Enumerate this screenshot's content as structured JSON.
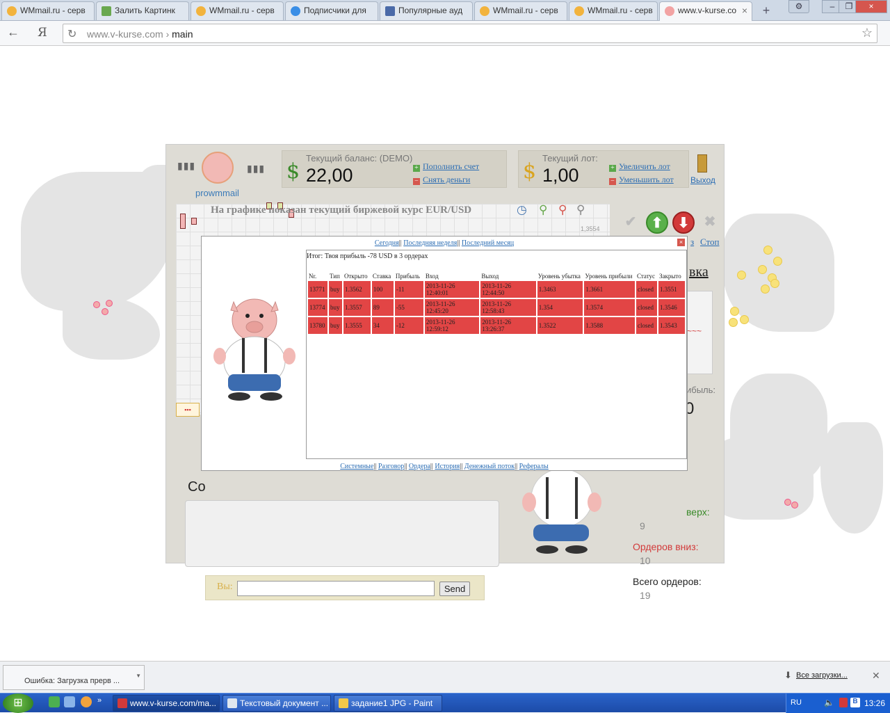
{
  "browser": {
    "tabs": [
      {
        "label": "WMmail.ru - серв",
        "active": false
      },
      {
        "label": "Залить Картинк",
        "active": false
      },
      {
        "label": "WMmail.ru - серв",
        "active": false
      },
      {
        "label": "Подписчики для",
        "active": false
      },
      {
        "label": "Популярные ауд",
        "active": false
      },
      {
        "label": "WMmail.ru - серв",
        "active": false
      },
      {
        "label": "WMmail.ru - серв",
        "active": false
      },
      {
        "label": "www.v-kurse.co",
        "active": true
      }
    ],
    "address": {
      "domain": "www.v-kurse.com",
      "separator": "›",
      "path": "main"
    }
  },
  "app": {
    "username": "prowmmail",
    "balance": {
      "label": "Текущий баланс: (DEMO)",
      "value": "22,00",
      "link_deposit": "Пополнить счет",
      "link_withdraw": "Снять деньги"
    },
    "lot": {
      "label": "Текущий лот:",
      "value": "1,00",
      "link_increase": "Увеличить лот",
      "link_decrease": "Уменьшить лот"
    },
    "exit_label": "Выход",
    "chart_title": "На графике показан текущий биржевой курс EUR/USD",
    "price_tick": "1,3554",
    "stop_link": "Стоп",
    "stop_partial": "з",
    "right_partial_heading": "вка",
    "profit_partial_label": "ибыль:",
    "profit_partial_value": "0",
    "chat_label_partial": "Со",
    "chat_you_label": "Вы:",
    "chat_send": "Send",
    "stats": {
      "up_label_partial": "верх:",
      "up_value": "9",
      "down_label": "Ордеров вниз:",
      "down_value": "10",
      "total_label": "Всего ордеров:",
      "total_value": "19"
    }
  },
  "modal": {
    "nav": [
      "Сегодня",
      "Последняя неделя",
      "Последний месяц"
    ],
    "nav_separator": "||",
    "summary": "Итог: Твоя прибыль -78 USD в 3 ордерах",
    "columns": [
      "Nr.",
      "Тип",
      "Открыто",
      "Ставка",
      "Прибыль",
      "Вход",
      "Выход",
      "Уровень убытка",
      "Уровень прибыли",
      "Статус",
      "Закрыто"
    ],
    "rows": [
      [
        "13771",
        "buy",
        "1.3562",
        "100",
        "-11",
        "2013-11-26 12:40:01",
        "2013-11-26 12:44:50",
        "1.3463",
        "1.3661",
        "closed",
        "1.3551"
      ],
      [
        "13774",
        "buy",
        "1.3557",
        "89",
        "-55",
        "2013-11-26 12:45:20",
        "2013-11-26 12:58:43",
        "1.354",
        "1.3574",
        "closed",
        "1.3546"
      ],
      [
        "13780",
        "buy",
        "1.3555",
        "34",
        "-12",
        "2013-11-26 12:59:12",
        "2013-11-26 13:26:37",
        "1.3522",
        "1.3588",
        "closed",
        "1.3543"
      ]
    ],
    "footer": [
      "Системные",
      "Разговор",
      "Ордера",
      "История",
      "Денежный поток",
      "Рефералы"
    ]
  },
  "downloads": {
    "item": "Ошибка: Загрузка прерв ...",
    "show_all": "Все загрузки..."
  },
  "taskbar": {
    "buttons": [
      "www.v-kurse.com/ma...",
      "Текстовый документ ...",
      "задание1 JPG - Paint"
    ],
    "lang": "RU",
    "clock": "13:26"
  },
  "colors": {
    "row_red": "#e24545",
    "link_blue": "#2a6cb3",
    "dollar_green": "#3a8a2a",
    "dollar_gold": "#d9a420"
  }
}
